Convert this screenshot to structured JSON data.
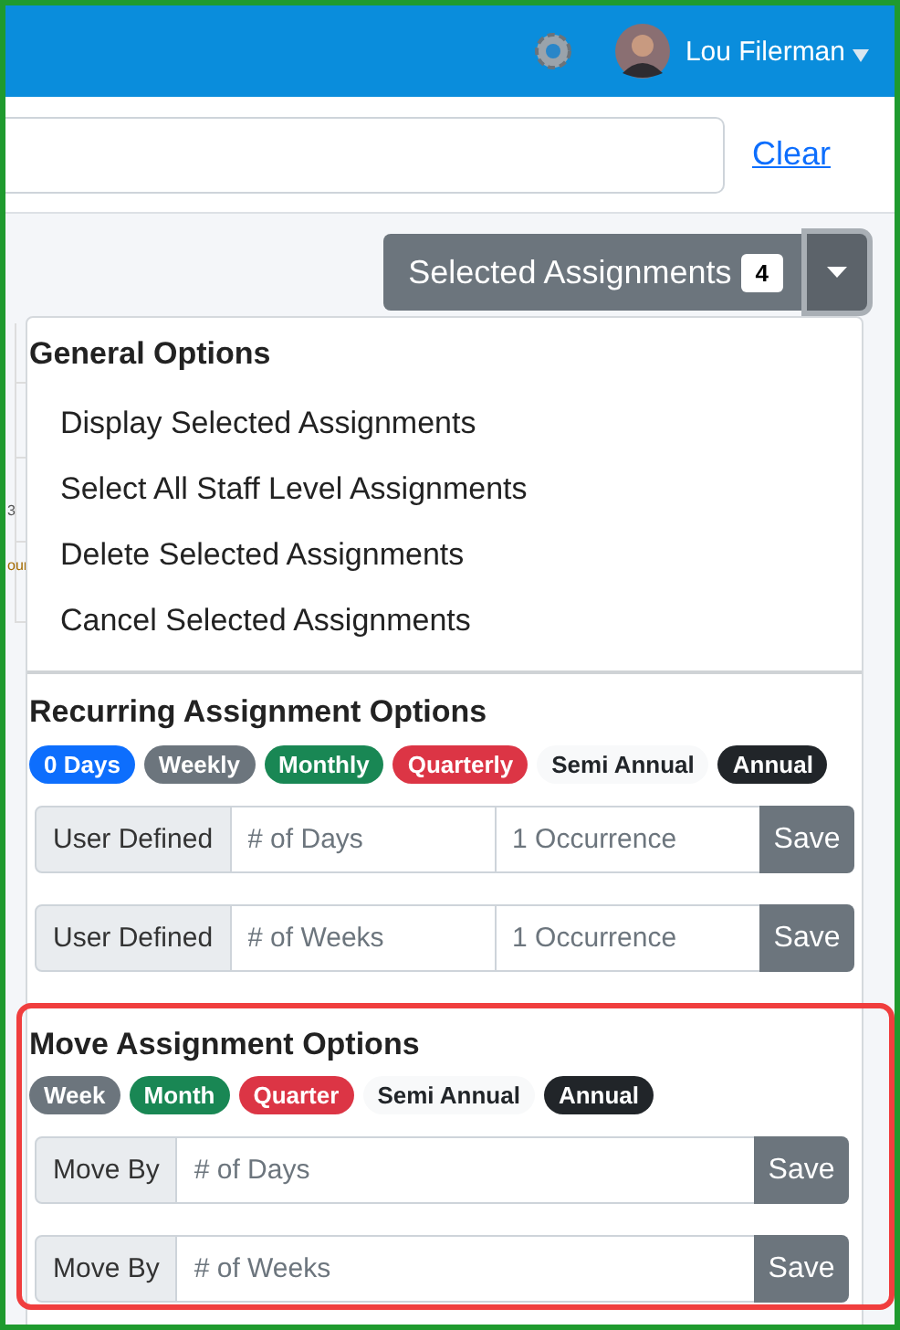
{
  "header": {
    "user_name": "Lou Filerman"
  },
  "search": {
    "link": "Clear"
  },
  "background_cells": [
    {
      "text": "3",
      "kind": "number"
    },
    {
      "text": "our",
      "kind": "event"
    }
  ],
  "selection_button": {
    "label": "Selected Assignments",
    "count": "4"
  },
  "general": {
    "heading": "General Options",
    "items": [
      "Display Selected Assignments",
      "Select All Staff Level Assignments",
      "Delete Selected Assignments",
      "Cancel Selected Assignments"
    ]
  },
  "recurring": {
    "heading": "Recurring Assignment Options",
    "pills": [
      {
        "label": "0 Days",
        "color": "#0d6efd"
      },
      {
        "label": "Weekly",
        "color": "#6c757d"
      },
      {
        "label": "Monthly",
        "color": "#198754"
      },
      {
        "label": "Quarterly",
        "color": "#dc3545"
      },
      {
        "label": "Semi Annual",
        "color": "#f8f9fa"
      },
      {
        "label": "Annual",
        "color": "#212529"
      }
    ],
    "rows": [
      {
        "label": "User Defined",
        "fields": [
          {
            "placeholder": "# of Days"
          },
          {
            "placeholder": "1 Occurrence"
          }
        ],
        "button": "Save"
      },
      {
        "label": "User Defined",
        "fields": [
          {
            "placeholder": "# of Weeks"
          },
          {
            "placeholder": "1 Occurrence"
          }
        ],
        "button": "Save"
      }
    ]
  },
  "move": {
    "heading": "Move Assignment Options",
    "pills": [
      {
        "label": "Week",
        "color": "#6c757d"
      },
      {
        "label": "Month",
        "color": "#198754"
      },
      {
        "label": "Quarter",
        "color": "#dc3545"
      },
      {
        "label": "Semi Annual",
        "color": "#f8f9fa"
      },
      {
        "label": "Annual",
        "color": "#212529"
      }
    ],
    "rows": [
      {
        "label": "Move By",
        "fields": [
          {
            "placeholder": "# of Days"
          }
        ],
        "button": "Save"
      },
      {
        "label": "Move By",
        "fields": [
          {
            "placeholder": "# of Weeks"
          }
        ],
        "button": "Save"
      }
    ]
  }
}
